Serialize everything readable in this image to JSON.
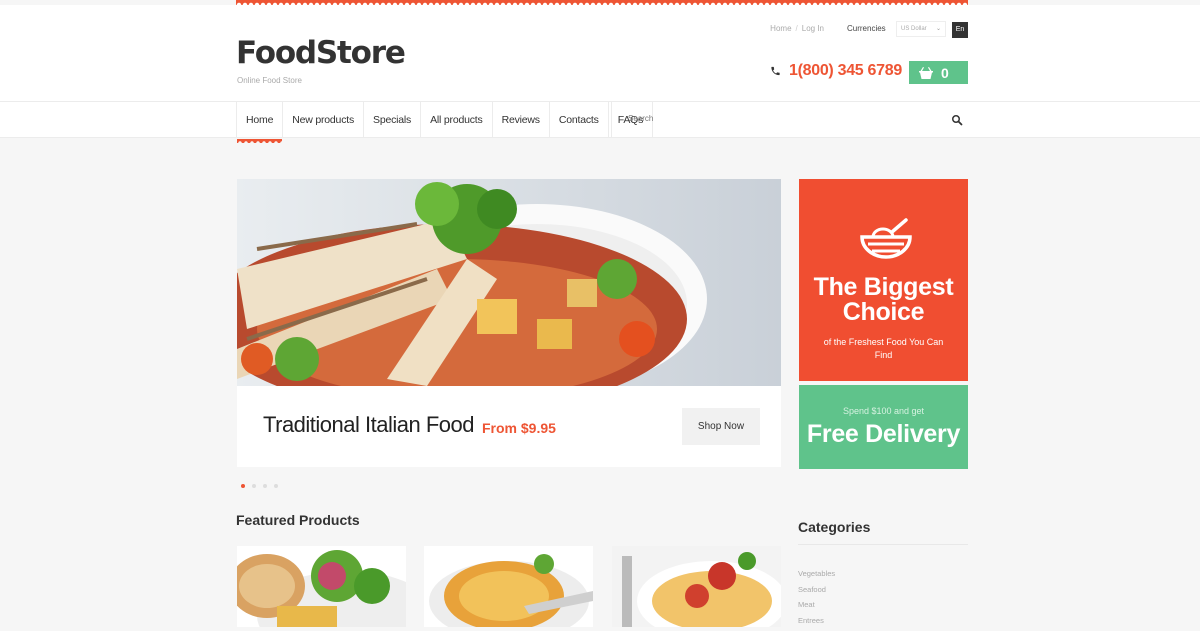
{
  "header": {
    "logo": "FoodStore",
    "tagline": "Online Food Store",
    "links": {
      "home": "Home",
      "sep": "/",
      "login": "Log In"
    },
    "currencies_label": "Currencies",
    "currency_value": "US Dollar",
    "language": "En",
    "phone": "1(800) 345 6789",
    "cart_count": "0"
  },
  "nav": {
    "items": [
      {
        "label": "Home"
      },
      {
        "label": "New products"
      },
      {
        "label": "Specials"
      },
      {
        "label": "All products"
      },
      {
        "label": "Reviews"
      },
      {
        "label": "Contacts"
      },
      {
        "label": "FAQs"
      }
    ],
    "search_placeholder": "Search"
  },
  "slider": {
    "title": "Traditional Italian Food",
    "price": "From $9.95",
    "button": "Shop Now",
    "active_index": 0,
    "total": 4
  },
  "promo": {
    "big_title": "The Biggest Choice",
    "big_sub": "of the Freshest Food You Can Find",
    "delivery_sub": "Spend $100 and get",
    "delivery_title": "Free Delivery"
  },
  "featured": {
    "title": "Featured Products"
  },
  "categories": {
    "title": "Categories",
    "items": [
      "Vegetables",
      "Seafood",
      "Meat",
      "Entrees"
    ]
  },
  "colors": {
    "accent_red": "#ee5534",
    "accent_green": "#5fc38b"
  }
}
